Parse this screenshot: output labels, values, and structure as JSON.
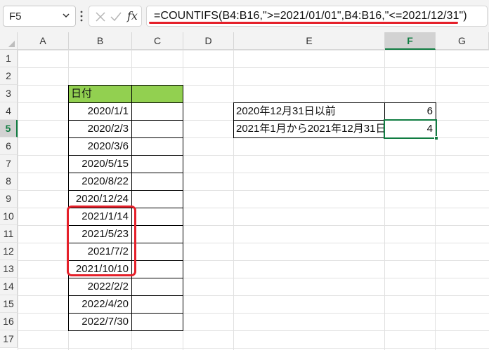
{
  "name_box": {
    "value": "F5"
  },
  "formula_bar": {
    "fx_label": "fx",
    "formula": "=COUNTIFS(B4:B16,\">=2021/01/01\",B4:B16,\"<=2021/12/31\")"
  },
  "columns": [
    "A",
    "B",
    "C",
    "D",
    "E",
    "F",
    "G"
  ],
  "rows": [
    "1",
    "2",
    "3",
    "4",
    "5",
    "6",
    "7",
    "8",
    "9",
    "10",
    "11",
    "12",
    "13",
    "14",
    "15",
    "16",
    "17"
  ],
  "selected": {
    "column": "F",
    "row": "5"
  },
  "table": {
    "header": "日付",
    "dates": [
      "2020/1/1",
      "2020/2/3",
      "2020/3/6",
      "2020/5/15",
      "2020/8/22",
      "2020/12/24",
      "2021/1/14",
      "2021/5/23",
      "2021/7/2",
      "2021/10/10",
      "2022/2/2",
      "2022/4/20",
      "2022/7/30"
    ]
  },
  "summary": [
    {
      "label": "2020年12月31日以前",
      "value": "6"
    },
    {
      "label": "2021年1月から2021年12月31日",
      "value": "4"
    }
  ],
  "colors": {
    "header_fill": "#92d050",
    "selection": "#107c41",
    "highlight": "#e5202a"
  }
}
